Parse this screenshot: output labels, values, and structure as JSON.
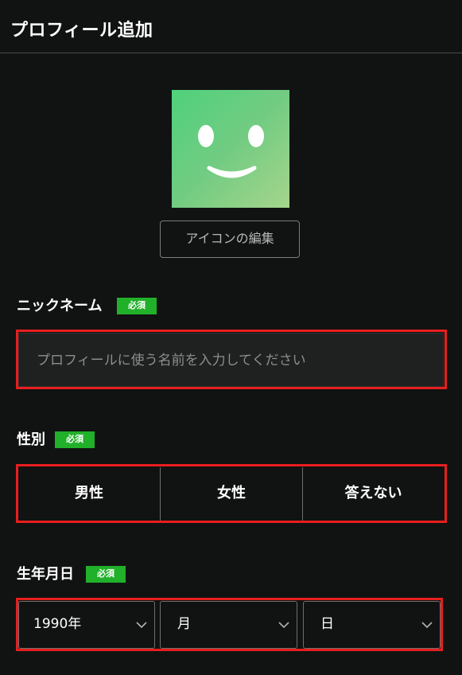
{
  "header": {
    "title": "プロフィール追加"
  },
  "avatar": {
    "icon": "smiley-face-icon",
    "gradient_colors": [
      "#4fd17c",
      "#a6d58c"
    ]
  },
  "edit_icon_button": {
    "label": "アイコンの編集"
  },
  "nickname": {
    "label": "ニックネーム",
    "badge": "必須",
    "placeholder": "プロフィールに使う名前を入力してください",
    "value": ""
  },
  "gender": {
    "label": "性別",
    "badge": "必須",
    "options": [
      "男性",
      "女性",
      "答えない"
    ]
  },
  "birthday": {
    "label": "生年月日",
    "badge": "必須",
    "year": "1990年",
    "month": "月",
    "day": "日"
  },
  "colors": {
    "background": "#111312",
    "badge": "#21b02a",
    "highlight": "#e81e1e"
  }
}
